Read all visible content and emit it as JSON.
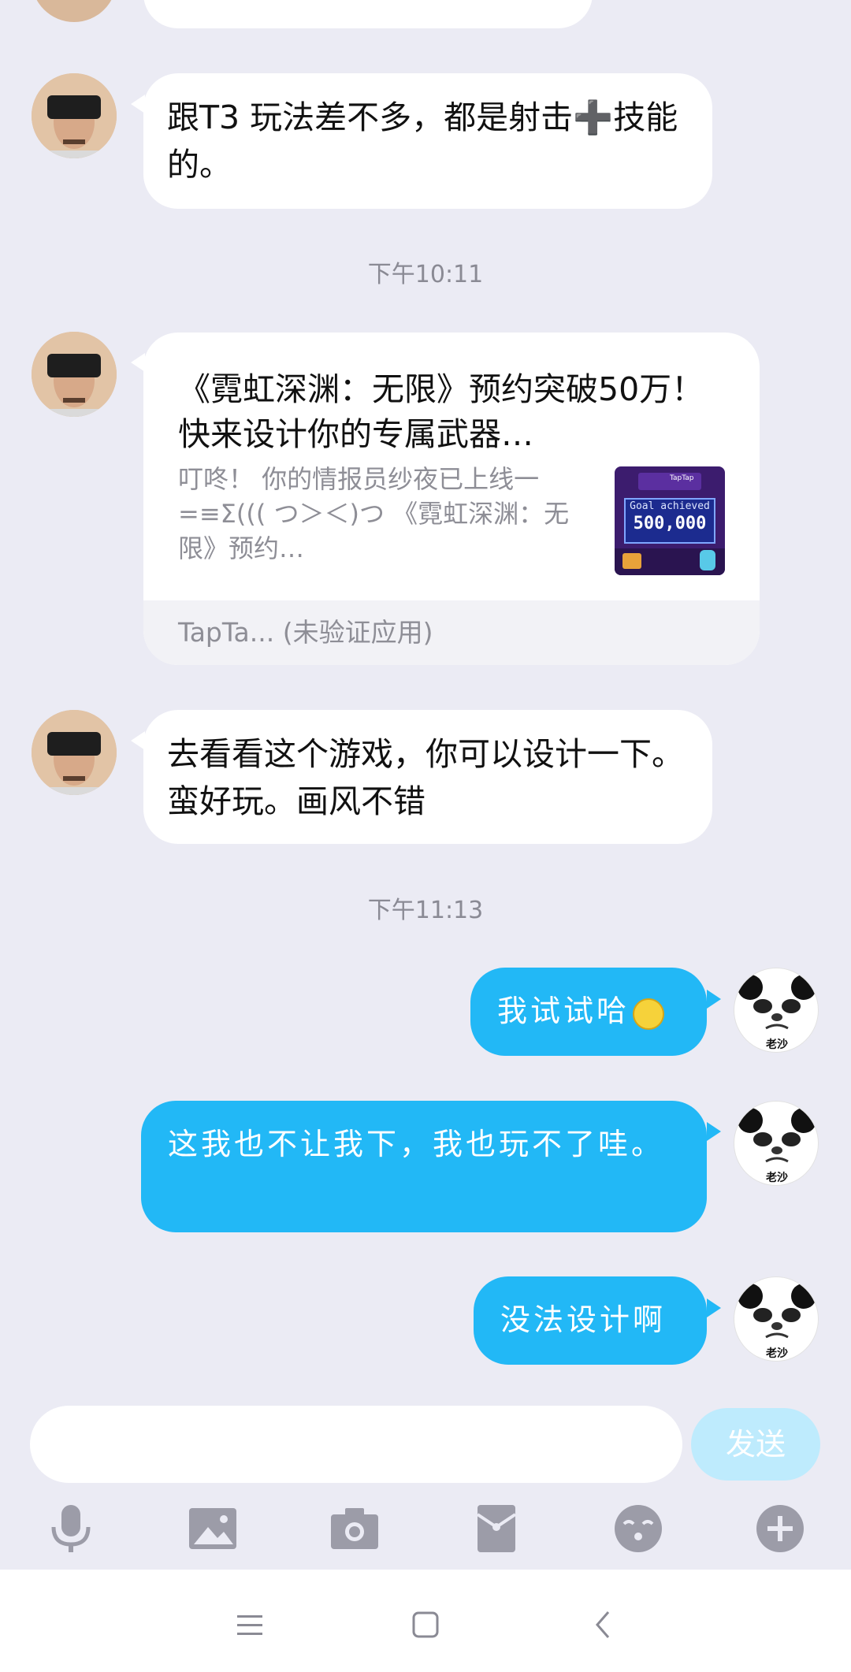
{
  "messages": {
    "m1_text": "跟T3 玩法差不多，都是射击➕技能的。",
    "time1": "下午10:11",
    "card": {
      "title": "《霓虹深渊：无限》预约突破50万！快来设计你的专属武器…",
      "desc": "叮咚！ 你的情报员纱夜已上线一=≡Σ((( つ＞＜)つ 《霓虹深渊：无限》预约…",
      "thumb_line1": "Goal achieved",
      "thumb_line2": "500,000",
      "thumb_brand": "TapTap",
      "source": "TapTa... (未验证应用)"
    },
    "m2_text": "去看看这个游戏，你可以设计一下。蛮好玩。画风不错",
    "time2": "下午11:13",
    "o1_text": "我试试哈",
    "o2_text": "这我也不让我下，我也玩不了哇。",
    "o3_text": "没法设计啊",
    "avatar_right_caption": "老沙"
  },
  "composer": {
    "input_value": "",
    "send_label": "发送"
  },
  "toolbar_icons": [
    "microphone-icon",
    "image-icon",
    "camera-icon",
    "red-packet-icon",
    "emoji-icon",
    "plus-icon"
  ],
  "navbar_icons": [
    "menu-icon",
    "home-icon",
    "back-icon"
  ],
  "colors": {
    "background": "#EBEBF4",
    "outgoing_bubble": "#22B8F6",
    "send_disabled": "#BEEBFD",
    "icon_gray": "#9C9CA8"
  }
}
